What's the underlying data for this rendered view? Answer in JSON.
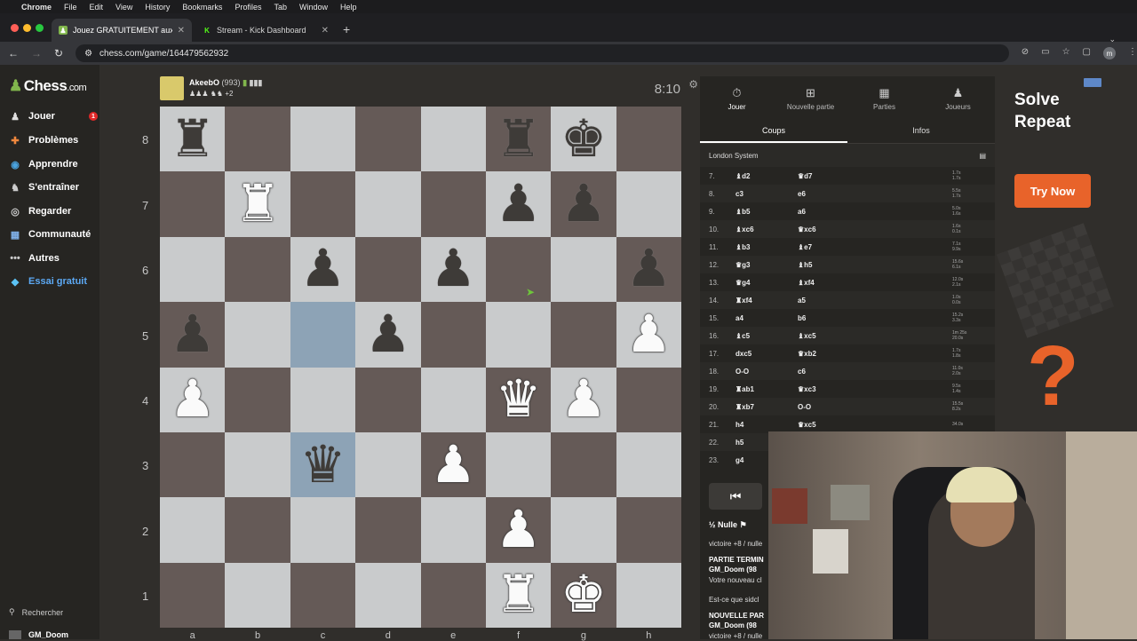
{
  "menubar": {
    "app": "Chrome",
    "items": [
      "File",
      "Edit",
      "View",
      "History",
      "Bookmarks",
      "Profiles",
      "Tab",
      "Window",
      "Help"
    ]
  },
  "tabs": [
    {
      "title": "Jouez GRATUITEMENT aux é",
      "active": true
    },
    {
      "title": "Stream - Kick Dashboard",
      "active": false
    }
  ],
  "address": {
    "url": "chess.com/game/164479562932",
    "profile_initial": "m"
  },
  "sidebar": {
    "logo": "Chess",
    "logo_suffix": ".com",
    "items": [
      {
        "label": "Jouer",
        "icon": "pawn-icon",
        "badge": "1"
      },
      {
        "label": "Problèmes",
        "icon": "puzzle-icon"
      },
      {
        "label": "Apprendre",
        "icon": "learn-icon"
      },
      {
        "label": "S'entraîner",
        "icon": "train-icon"
      },
      {
        "label": "Regarder",
        "icon": "watch-icon"
      },
      {
        "label": "Communauté",
        "icon": "community-icon"
      },
      {
        "label": "Autres",
        "icon": "more-icon"
      },
      {
        "label": "Essai gratuit",
        "icon": "diamond-icon"
      }
    ],
    "search": "Rechercher",
    "user": "GM_Doom"
  },
  "player": {
    "name": "AkeebO",
    "rating": "(993)",
    "extra": "+2",
    "clock": "8:10"
  },
  "board": {
    "ranks": [
      "8",
      "7",
      "6",
      "5",
      "4",
      "3",
      "2",
      "1"
    ],
    "files": [
      "a",
      "b",
      "c",
      "d",
      "e",
      "f",
      "g",
      "h"
    ],
    "rows": [
      [
        "bR",
        "",
        "",
        "",
        "",
        "bR",
        "bK",
        ""
      ],
      [
        "",
        "wR",
        "",
        "",
        "",
        "bP",
        "bP",
        ""
      ],
      [
        "",
        "",
        "bP",
        "",
        "bP",
        "",
        "",
        "bP"
      ],
      [
        "bP",
        "",
        "",
        "bP",
        "",
        "",
        "",
        "wP"
      ],
      [
        "wP",
        "",
        "",
        "",
        "",
        "wQ",
        "wP",
        ""
      ],
      [
        "",
        "",
        "bQ",
        "",
        "wP",
        "",
        "",
        ""
      ],
      [
        "",
        "",
        "",
        "",
        "",
        "wP",
        "",
        ""
      ],
      [
        "",
        "",
        "",
        "",
        "",
        "wR",
        "wK",
        ""
      ]
    ],
    "highlight": [
      "c5",
      "c3"
    ]
  },
  "panel": {
    "tabs": [
      {
        "label": "Jouer",
        "icon": "stopwatch-icon"
      },
      {
        "label": "Nouvelle partie",
        "icon": "plus-icon"
      },
      {
        "label": "Parties",
        "icon": "board-icon"
      },
      {
        "label": "Joueurs",
        "icon": "players-icon"
      }
    ],
    "subtabs": [
      "Coups",
      "Infos"
    ],
    "opening": "London System",
    "moves": [
      {
        "n": "7.",
        "w": "♝d2",
        "b": "♛d7",
        "tw": "1.7s",
        "tb": "1.7s"
      },
      {
        "n": "8.",
        "w": "c3",
        "b": "e6",
        "tw": "5.5s",
        "tb": "1.7s"
      },
      {
        "n": "9.",
        "w": "♝b5",
        "b": "a6",
        "tw": "5.0s",
        "tb": "1.6s"
      },
      {
        "n": "10.",
        "w": "♝xc6",
        "b": "♛xc6",
        "tw": "1.6s",
        "tb": "0.1s"
      },
      {
        "n": "11.",
        "w": "♝b3",
        "b": "♝e7",
        "tw": "7.1s",
        "tb": "9.9s"
      },
      {
        "n": "12.",
        "w": "♛g3",
        "b": "♝h5",
        "tw": "15.6s",
        "tb": "6.1s"
      },
      {
        "n": "13.",
        "w": "♛g4",
        "b": "♝xf4",
        "tw": "12.0s",
        "tb": "2.1s"
      },
      {
        "n": "14.",
        "w": "♜xf4",
        "b": "a5",
        "tw": "1.0s",
        "tb": "0.0s"
      },
      {
        "n": "15.",
        "w": "a4",
        "b": "b6",
        "tw": "15.2s",
        "tb": "3.3s"
      },
      {
        "n": "16.",
        "w": "♝c5",
        "b": "♝xc5",
        "tw": "1m 25s",
        "tb": "20.0s"
      },
      {
        "n": "17.",
        "w": "dxc5",
        "b": "♛xb2",
        "tw": "1.7s",
        "tb": "1.8s"
      },
      {
        "n": "18.",
        "w": "O-O",
        "b": "c6",
        "tw": "11.0s",
        "tb": "2.0s"
      },
      {
        "n": "19.",
        "w": "♜ab1",
        "b": "♛xc3",
        "tw": "9.5s",
        "tb": "1.4s"
      },
      {
        "n": "20.",
        "w": "♜xb7",
        "b": "O-O",
        "tw": "15.5s",
        "tb": "8.2s"
      },
      {
        "n": "21.",
        "w": "h4",
        "b": "♛xc5",
        "tw": "34.0s",
        "tb": ""
      },
      {
        "n": "22.",
        "w": "h5",
        "b": "",
        "tw": "",
        "tb": ""
      },
      {
        "n": "23.",
        "w": "g4",
        "b": "",
        "tw": "",
        "tb": ""
      }
    ],
    "draw_label": "Nulle",
    "draw_frac": "½",
    "chat": [
      "victoire +8 / nulle",
      "PARTIE TERMIN",
      "GM_Doom (98",
      "Votre nouveau cl",
      "Est-ce que sidcl",
      "NOUVELLE PAR",
      "GM_Doom (98",
      "victoire +8 / nulle"
    ]
  },
  "ad": {
    "title_line1": "Solve",
    "title_line2": "Repeat",
    "button": "Try Now",
    "accent": "#e8632a"
  },
  "colors": {
    "light_square": "#c9cbcc",
    "dark_square": "#655a57",
    "highlight": "#8da3b6",
    "brand_green": "#81b64c"
  }
}
